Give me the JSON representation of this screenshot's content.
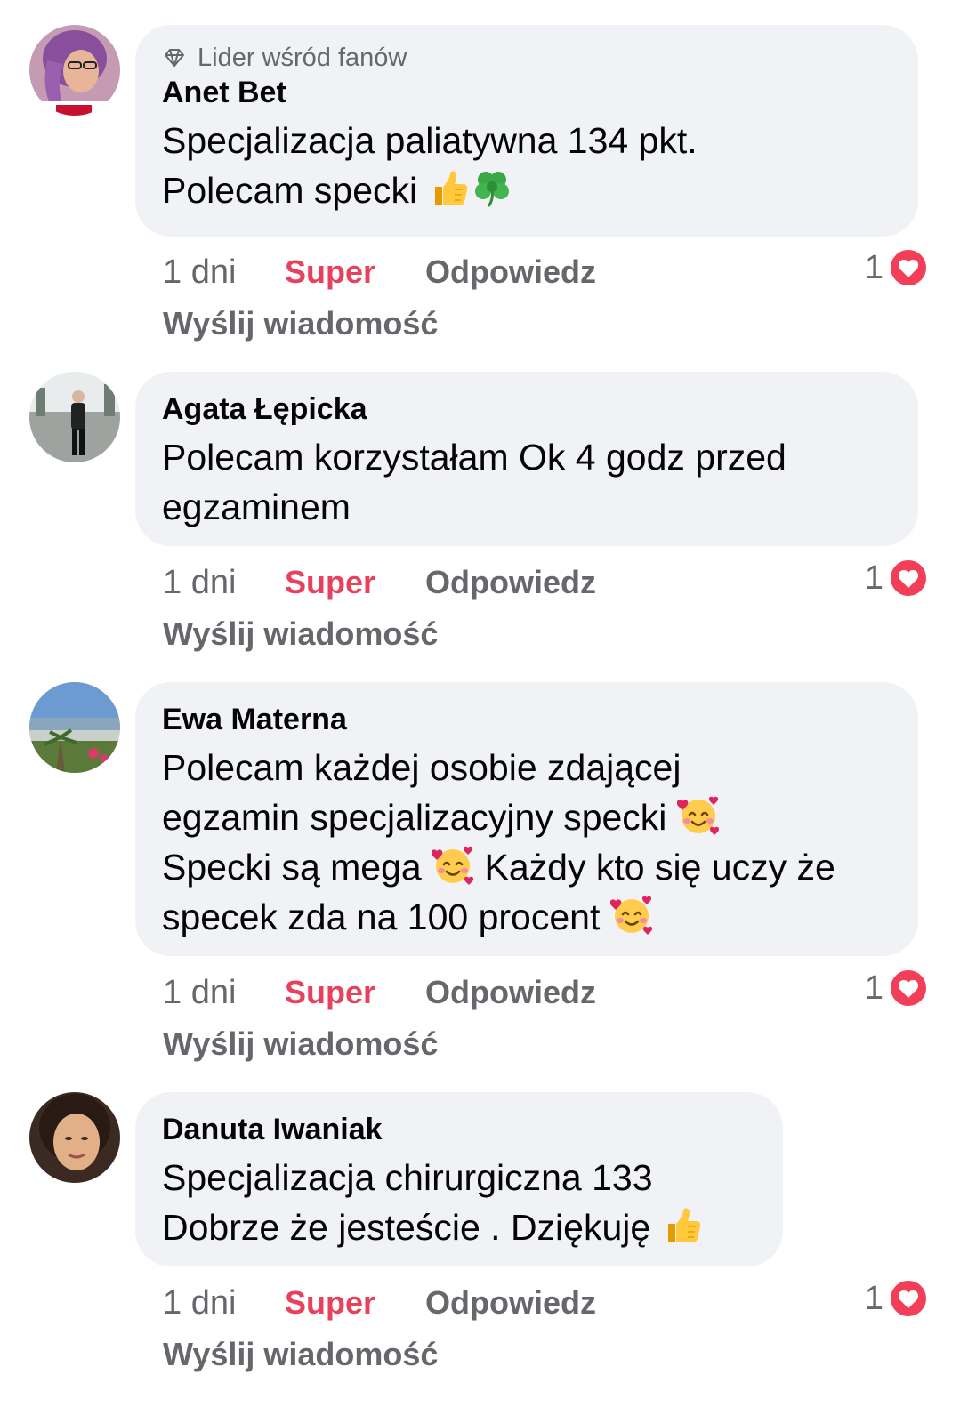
{
  "colors": {
    "bubble_bg": "#f0f2f5",
    "secondary_text": "#65676b",
    "like_active": "#e8415e",
    "heart": "#f33e58"
  },
  "icons": {
    "fan_badge": "diamond-icon",
    "reaction": "love-heart-icon",
    "emoji_thumbs_up": "thumbs-up-emoji",
    "emoji_clover": "four-leaf-clover-emoji",
    "emoji_smiling_hearts": "smiling-face-with-hearts-emoji"
  },
  "comments": [
    {
      "badge": "Lider wśród fanów",
      "author": "Anet Bet",
      "lines": [
        "Specjalizacja paliatywna 134 pkt.",
        "Polecam specki"
      ],
      "time": "1 dni",
      "like": "Super",
      "reply": "Odpowiedz",
      "send": "Wyślij wiadomość",
      "reaction_count": "1"
    },
    {
      "author": "Agata Łępicka",
      "lines": [
        "Polecam korzystałam Ok 4 godz przed",
        "egzaminem"
      ],
      "time": "1 dni",
      "like": "Super",
      "reply": "Odpowiedz",
      "send": "Wyślij wiadomość",
      "reaction_count": "1"
    },
    {
      "author": "Ewa Materna",
      "lines": [
        "Polecam każdej osobie zdającej",
        "egzamin specjalizacyjny specki",
        "Specki są mega",
        "Każdy kto się uczy że",
        "specek zda na 100 procent"
      ],
      "time": "1 dni",
      "like": "Super",
      "reply": "Odpowiedz",
      "send": "Wyślij wiadomość",
      "reaction_count": "1"
    },
    {
      "author": "Danuta Iwaniak",
      "lines": [
        "Specjalizacja chirurgiczna 133",
        "Dobrze że jesteście . Dziękuję"
      ],
      "time": "1 dni",
      "like": "Super",
      "reply": "Odpowiedz",
      "send": "Wyślij wiadomość",
      "reaction_count": "1"
    }
  ]
}
